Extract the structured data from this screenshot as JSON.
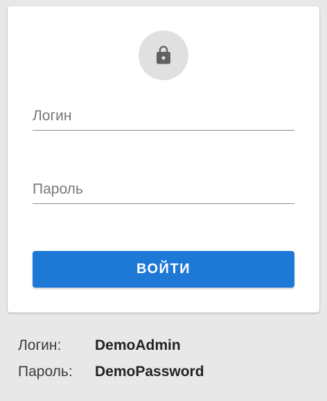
{
  "login_form": {
    "icon": "lock-icon",
    "username_placeholder": "Логин",
    "username_value": "",
    "password_placeholder": "Пароль",
    "password_value": "",
    "submit_label": "ВОЙТИ"
  },
  "demo_credentials": {
    "login_label": "Логин:",
    "login_value": "DemoAdmin",
    "password_label": "Пароль:",
    "password_value": "DemoPassword"
  },
  "colors": {
    "background": "#e8e8e8",
    "card": "#ffffff",
    "avatar_bg": "#e0e0e0",
    "accent": "#1e78d6",
    "field_border": "#8a8a8a"
  }
}
